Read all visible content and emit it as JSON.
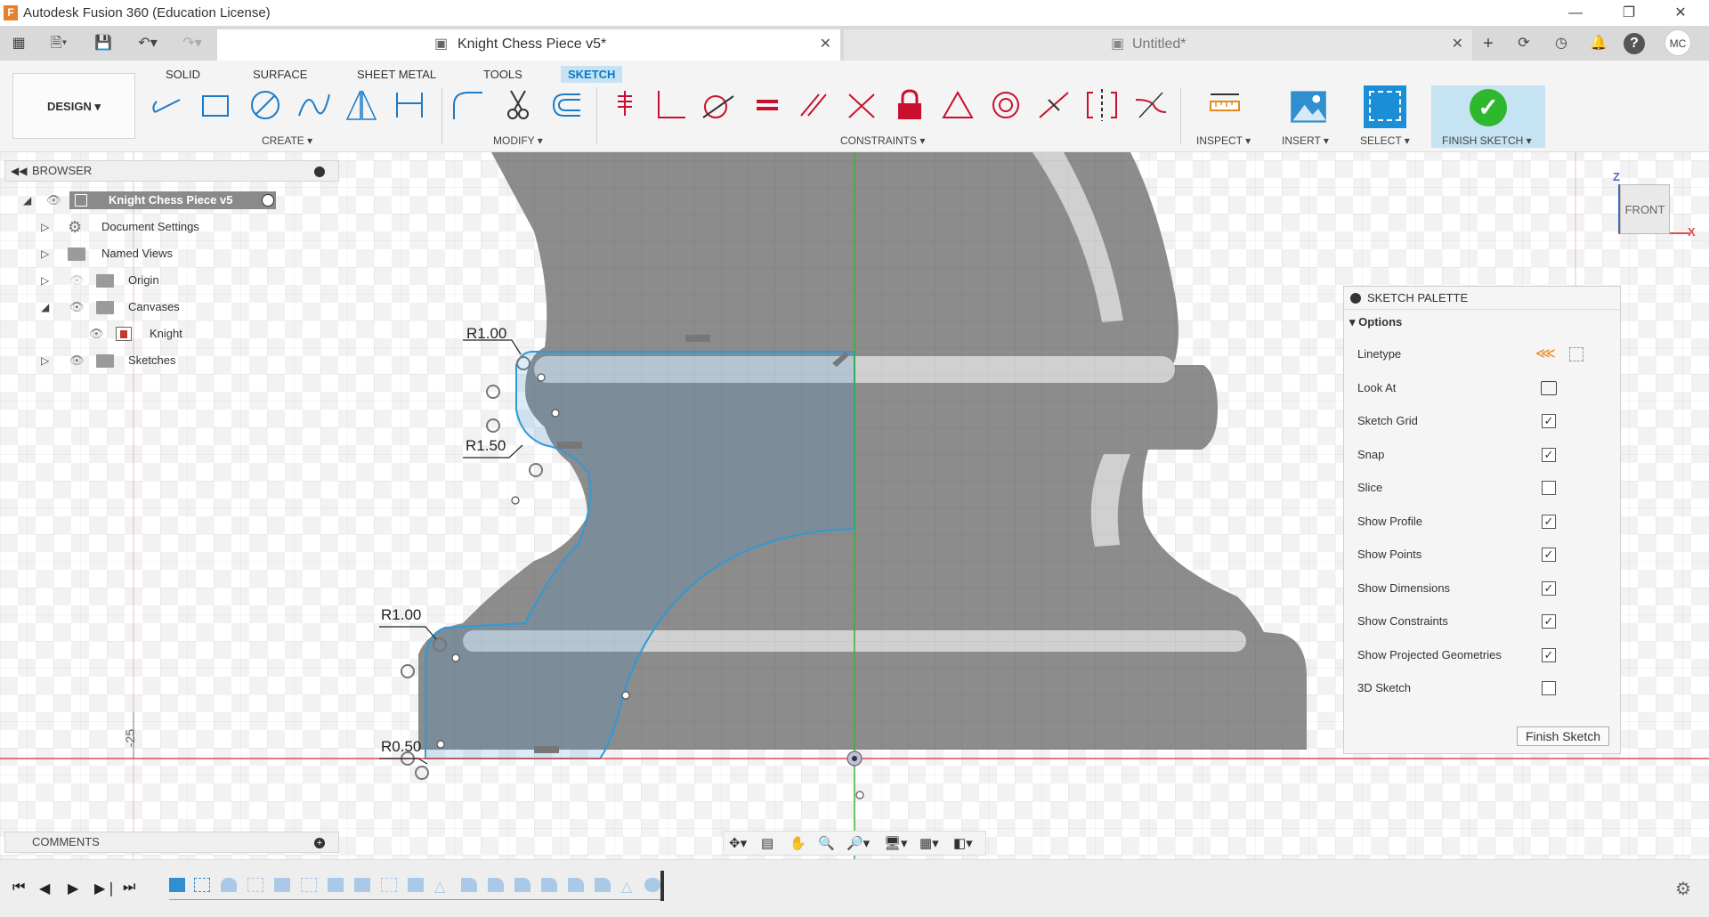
{
  "window": {
    "title": "Autodesk Fusion 360 (Education License)"
  },
  "tabs": {
    "active": "Knight Chess Piece v5*",
    "inactive": "Untitled*",
    "user_initials": "MC"
  },
  "ribbon": {
    "workspace": "DESIGN",
    "tabs": [
      "SOLID",
      "SURFACE",
      "SHEET METAL",
      "TOOLS",
      "SKETCH"
    ],
    "active_tab": "SKETCH",
    "groups": {
      "create": "CREATE",
      "modify": "MODIFY",
      "constraints": "CONSTRAINTS",
      "inspect": "INSPECT",
      "insert": "INSERT",
      "select": "SELECT",
      "finish": "FINISH SKETCH"
    }
  },
  "browser": {
    "header": "BROWSER",
    "root": "Knight Chess Piece v5",
    "items": [
      {
        "label": "Document Settings"
      },
      {
        "label": "Named Views"
      },
      {
        "label": "Origin"
      },
      {
        "label": "Canvases"
      },
      {
        "label": "Knight"
      },
      {
        "label": "Sketches"
      }
    ]
  },
  "comments": {
    "header": "COMMENTS"
  },
  "viewcube": {
    "face": "FRONT",
    "axis_z": "Z",
    "axis_x": "X"
  },
  "dimensions": {
    "d1": "R1.00",
    "d2": "R1.50",
    "d3": "R1.00",
    "d4": "R0.50",
    "ruler": "-25"
  },
  "palette": {
    "title": "SKETCH PALETTE",
    "section": "Options",
    "rows": [
      {
        "label": "Linetype"
      },
      {
        "label": "Look At"
      },
      {
        "label": "Sketch Grid",
        "checked": true
      },
      {
        "label": "Snap",
        "checked": true
      },
      {
        "label": "Slice",
        "checked": false
      },
      {
        "label": "Show Profile",
        "checked": true
      },
      {
        "label": "Show Points",
        "checked": true
      },
      {
        "label": "Show Dimensions",
        "checked": true
      },
      {
        "label": "Show Constraints",
        "checked": true
      },
      {
        "label": "Show Projected Geometries",
        "checked": true
      },
      {
        "label": "3D Sketch",
        "checked": false
      }
    ],
    "finish_button": "Finish Sketch"
  },
  "colors": {
    "accent": "#0696d7",
    "finish_green": "#2eb82e",
    "sketch_line": "#2f9ad8",
    "axis_red": "#e04b4b",
    "axis_green": "#3ab03a"
  }
}
